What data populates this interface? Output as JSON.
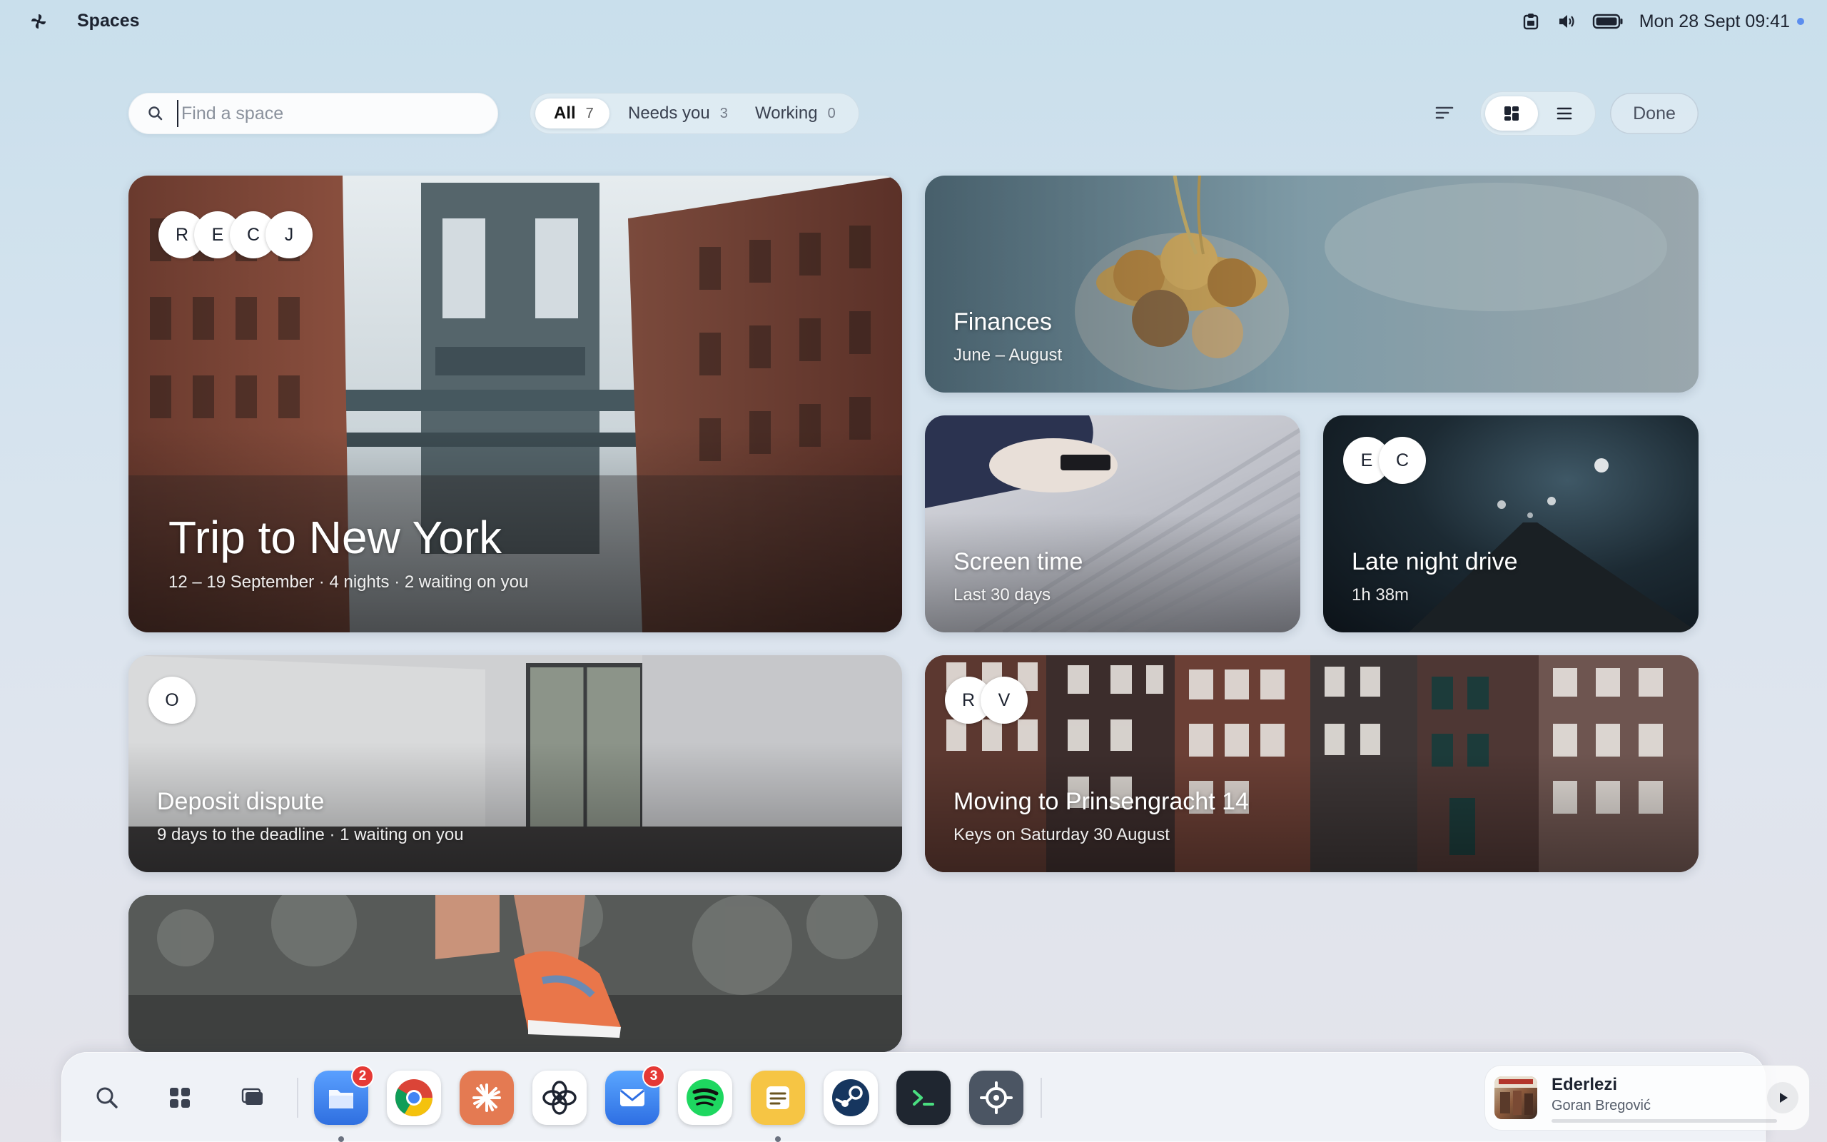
{
  "menubar": {
    "logo_icon": "spiral-logo-icon",
    "app_name": "Spaces",
    "tray_icons": [
      "clipboard-icon",
      "volume-icon",
      "battery-icon"
    ],
    "clock": "Mon 28 Sept 09:41"
  },
  "toolbar": {
    "search_placeholder": "Find a space",
    "search_value": "",
    "filters": [
      {
        "label": "All",
        "count": "7",
        "active": true
      },
      {
        "label": "Needs you",
        "count": "3",
        "active": false
      },
      {
        "label": "Working",
        "count": "0",
        "active": false
      }
    ],
    "view_mode": "grid",
    "done_label": "Done"
  },
  "cards": [
    {
      "id": "ny",
      "title": "Trip to New York",
      "subtitle": "12 – 19 September · 4 nights · 2 waiting on you",
      "avatars": [
        "R",
        "E",
        "C",
        "J"
      ]
    },
    {
      "id": "fin",
      "title": "Finances",
      "subtitle": "June – August",
      "avatars": []
    },
    {
      "id": "screen",
      "title": "Screen time",
      "subtitle": "Last 30 days",
      "avatars": []
    },
    {
      "id": "drive",
      "title": "Late night drive",
      "subtitle": "1h 38m",
      "avatars": [
        "E",
        "C"
      ]
    },
    {
      "id": "deposit",
      "title": "Deposit dispute",
      "subtitle": "9 days to the deadline · 1 waiting on you",
      "avatars": [
        "O"
      ]
    },
    {
      "id": "moving",
      "title": "Moving to Prinsengracht 14",
      "subtitle": "Keys on Saturday 30 August",
      "avatars": [
        "R",
        "V"
      ]
    },
    {
      "id": "run",
      "title": "",
      "subtitle": "",
      "avatars": []
    }
  ],
  "dock": {
    "system_icons": [
      "search-icon",
      "apps-grid-icon",
      "windows-icon"
    ],
    "apps": [
      {
        "name": "files",
        "icon": "files-icon",
        "color": "#3b82f6",
        "badge": "2",
        "running": true
      },
      {
        "name": "chrome",
        "icon": "chrome-icon",
        "color": "#ffffff",
        "badge": "",
        "running": false
      },
      {
        "name": "claude",
        "icon": "claude-icon",
        "color": "#e8784f",
        "badge": "",
        "running": false
      },
      {
        "name": "chatgpt",
        "icon": "chatgpt-icon",
        "color": "#ffffff",
        "badge": "",
        "running": false
      },
      {
        "name": "mail",
        "icon": "mail-icon",
        "color": "#3b82f6",
        "badge": "3",
        "running": false
      },
      {
        "name": "spotify",
        "icon": "spotify-icon",
        "color": "#ffffff",
        "badge": "",
        "running": false
      },
      {
        "name": "notes",
        "icon": "notes-icon",
        "color": "#f5c542",
        "badge": "",
        "running": true
      },
      {
        "name": "steam",
        "icon": "steam-icon",
        "color": "#ffffff",
        "badge": "",
        "running": false
      },
      {
        "name": "terminal",
        "icon": "terminal-icon",
        "color": "#1f2937",
        "badge": "",
        "running": false
      },
      {
        "name": "settings",
        "icon": "settings-icon",
        "color": "#4b5563",
        "badge": "",
        "running": false
      }
    ],
    "now_playing": {
      "track": "Ederlezi",
      "artist": "Goran Bregović",
      "progress": 0.0
    }
  }
}
